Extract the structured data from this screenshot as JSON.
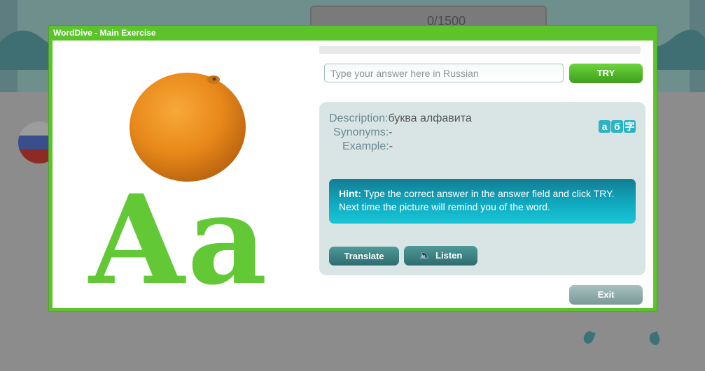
{
  "dialog": {
    "title": "WordDive - Main Exercise"
  },
  "background": {
    "score": "0/1500"
  },
  "exercise": {
    "image": "orange-image",
    "letters": "Aa",
    "progress": 0,
    "answer_placeholder": "Type your answer here in Russian",
    "answer_value": "",
    "try_label": "TRY",
    "exit_label": "Exit"
  },
  "info": {
    "description_label": "Description:",
    "description_value": "буква алфавита",
    "synonyms_label": "Synonyms:",
    "synonyms_value": "-",
    "example_label": "Example:",
    "example_value": "-",
    "script_icons": [
      "а",
      "б",
      "字"
    ]
  },
  "hint": {
    "label": "Hint:",
    "text": "Type the correct answer in the answer field and click TRY. Next time the picture will remind you of the word."
  },
  "buttons": {
    "translate_label": "Translate",
    "listen_label": "Listen"
  },
  "colors": {
    "dialog_frame": "#5cc42a",
    "try_button": "#4fb82a",
    "hint_panel": "#10aac0",
    "info_panel": "#d9e5e5"
  }
}
